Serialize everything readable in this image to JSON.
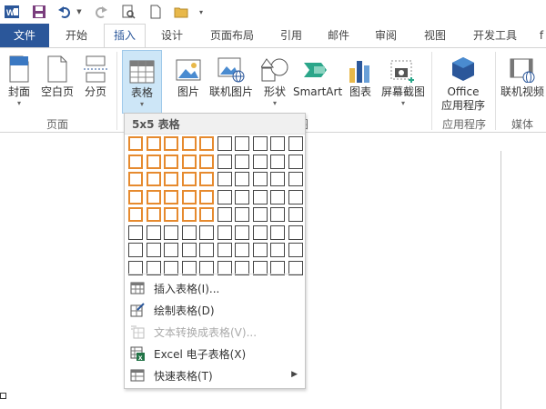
{
  "titlebar": {
    "icons": [
      "word-app-icon",
      "save-icon",
      "undo-icon",
      "redo-icon",
      "print-preview-icon",
      "new-document-icon",
      "open-folder-icon",
      "customize-quick-access-icon"
    ]
  },
  "tabs": {
    "items": [
      "文件",
      "开始",
      "插入",
      "设计",
      "页面布局",
      "引用",
      "邮件",
      "审阅",
      "视图",
      "开发工具",
      "f"
    ],
    "active": "插入"
  },
  "ribbon": {
    "buttons": {
      "cover": "封面",
      "blank": "空白页",
      "pagebreak": "分页",
      "table": "表格",
      "picture": "图片",
      "online_picture": "联机图片",
      "shapes": "形状",
      "smartart": "SmartArt",
      "chart": "图表",
      "screenshot": "屏幕截图",
      "office_apps_line1": "Office",
      "office_apps_line2": "应用程序",
      "online_video": "联机视频"
    },
    "groups": {
      "pages": "页面",
      "illustrations_tail": "图",
      "apps": "应用程序",
      "media": "媒体"
    }
  },
  "dropdown": {
    "header": "5x5 表格",
    "grid": {
      "rows": 8,
      "cols": 10,
      "selected_rows": 5,
      "selected_cols": 5
    },
    "menu": [
      {
        "label": "插入表格(I)...",
        "icon": "insert-table-icon",
        "enabled": true
      },
      {
        "label": "绘制表格(D)",
        "icon": "draw-table-icon",
        "enabled": true
      },
      {
        "label": "文本转换成表格(V)...",
        "icon": "convert-text-to-table-icon",
        "enabled": false
      },
      {
        "label": "Excel 电子表格(X)",
        "icon": "excel-spreadsheet-icon",
        "enabled": true
      },
      {
        "label": "快速表格(T)",
        "icon": "quick-tables-icon",
        "enabled": true,
        "submenu": true
      }
    ]
  },
  "colors": {
    "accent": "#2b579a",
    "highlight": "#e68a2e",
    "selected_bg": "#cde6f7"
  }
}
